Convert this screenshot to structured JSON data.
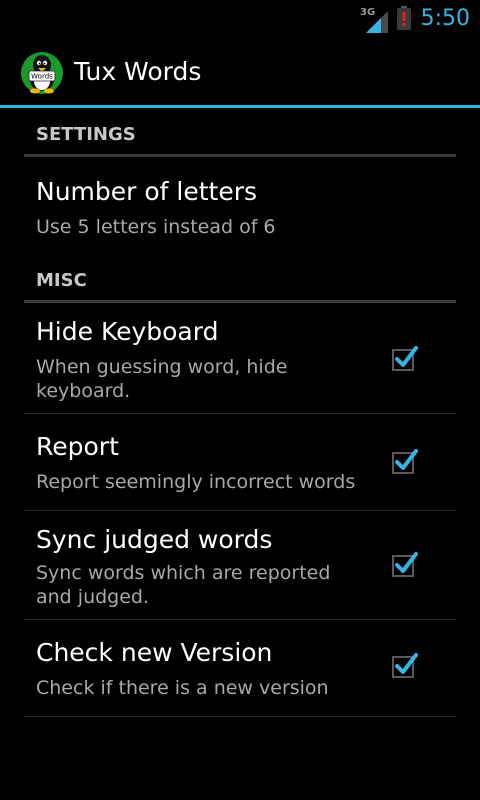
{
  "status_bar": {
    "network": "3G",
    "time": "5:50",
    "icons": [
      "signal-3g-icon",
      "battery-alert-icon"
    ],
    "time_color": "#33b5e5"
  },
  "action_bar": {
    "title": "Tux Words",
    "icon": "tux-words-app-icon",
    "accent_color": "#33b5e5",
    "icon_badge": "Words"
  },
  "settings_category": {
    "label": "SETTINGS"
  },
  "misc_category": {
    "label": "MISC"
  },
  "preferences": {
    "number_of_letters": {
      "title": "Number of letters",
      "summary": "Use 5 letters instead of 6"
    },
    "hide_keyboard": {
      "title": "Hide Keyboard",
      "summary": "When guessing word, hide keyboard.",
      "checked": true
    },
    "report": {
      "title": "Report",
      "summary": "Report seemingly incorrect words",
      "checked": true
    },
    "sync_judged_words": {
      "title": "Sync judged words",
      "summary": "Sync words which are reported and judged.",
      "checked": true
    },
    "check_new_version": {
      "title": "Check new Version",
      "summary": "Check if there is a new version",
      "checked": true
    }
  }
}
